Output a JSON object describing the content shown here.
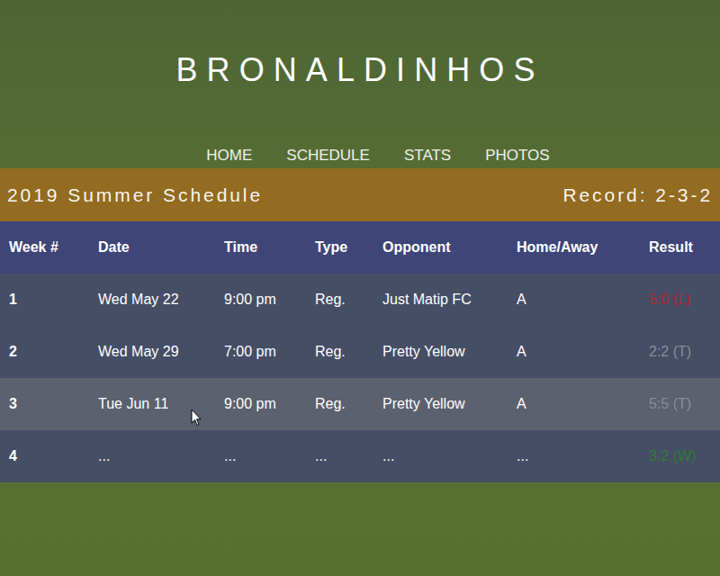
{
  "site": {
    "title": "BRONALDINHOS"
  },
  "nav": [
    {
      "label": "HOME"
    },
    {
      "label": "SCHEDULE"
    },
    {
      "label": "STATS"
    },
    {
      "label": "PHOTOS"
    }
  ],
  "schedule": {
    "title": "2019 Summer Schedule",
    "record": "Record: 2-3-2"
  },
  "table": {
    "columns": [
      "Week #",
      "Date",
      "Time",
      "Type",
      "Opponent",
      "Home/Away",
      "Result"
    ],
    "rows": [
      {
        "cells": [
          "1",
          "Wed May 22",
          "9:00 pm",
          "Reg.",
          "Just Matip FC",
          "A"
        ],
        "result": "5:0 (L)",
        "color": "#b3262a",
        "hovered": false
      },
      {
        "cells": [
          "2",
          "Wed May 29",
          "7:00 pm",
          "Reg.",
          "Pretty Yellow",
          "A"
        ],
        "result": "2:2 (T)",
        "color": "#8a8c96",
        "hovered": false
      },
      {
        "cells": [
          "3",
          "Tue Jun 11",
          "9:00 pm",
          "Reg.",
          "Pretty Yellow",
          "A"
        ],
        "result": "5:5 (T)",
        "color": "#8a8c96",
        "hovered": true
      },
      {
        "cells": [
          "4",
          "...",
          "...",
          "...",
          "...",
          "..."
        ],
        "result": "3:2 (W)",
        "color": "#2e7d32",
        "hovered": false
      }
    ]
  }
}
